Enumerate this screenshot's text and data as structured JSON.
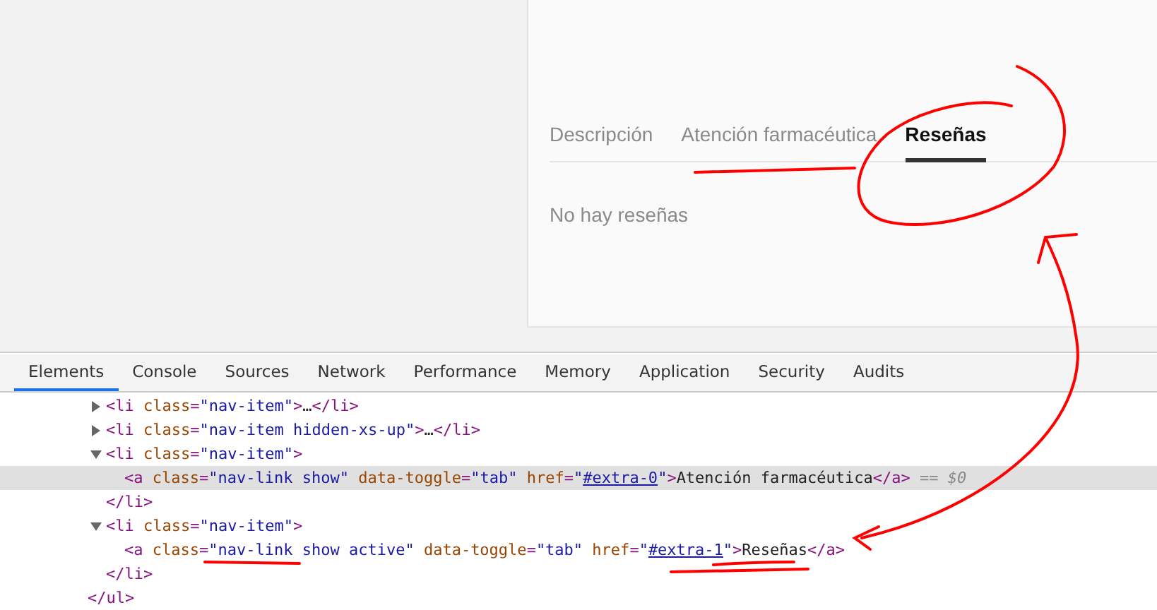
{
  "product_card": {
    "tabs": [
      {
        "label": "Descripción",
        "selected": false
      },
      {
        "label": "Atención farmacéutica",
        "selected": false
      },
      {
        "label": "Reseñas",
        "selected": true
      }
    ],
    "message": "No hay reseñas"
  },
  "devtools": {
    "tabs": [
      {
        "label": "Elements",
        "selected": true
      },
      {
        "label": "Console",
        "selected": false
      },
      {
        "label": "Sources",
        "selected": false
      },
      {
        "label": "Network",
        "selected": false
      },
      {
        "label": "Performance",
        "selected": false
      },
      {
        "label": "Memory",
        "selected": false
      },
      {
        "label": "Application",
        "selected": false
      },
      {
        "label": "Security",
        "selected": false
      },
      {
        "label": "Audits",
        "selected": false
      }
    ],
    "dom": {
      "children": [
        {
          "kind": "element",
          "expanded": false,
          "selected": false,
          "tokens": [
            {
              "kind": "tag",
              "t": "<li"
            },
            {
              "kind": "attr",
              "t": " class"
            },
            {
              "kind": "tag",
              "t": "="
            },
            {
              "kind": "value",
              "t": "\"nav-item\""
            },
            {
              "kind": "tag",
              "t": ">"
            },
            {
              "kind": "text",
              "t": "…"
            },
            {
              "kind": "tag",
              "t": "</li>"
            }
          ]
        },
        {
          "kind": "element",
          "expanded": false,
          "selected": false,
          "tokens": [
            {
              "kind": "tag",
              "t": "<li"
            },
            {
              "kind": "attr",
              "t": " class"
            },
            {
              "kind": "tag",
              "t": "="
            },
            {
              "kind": "value",
              "t": "\"nav-item hidden-xs-up\""
            },
            {
              "kind": "tag",
              "t": ">"
            },
            {
              "kind": "text",
              "t": "…"
            },
            {
              "kind": "tag",
              "t": "</li>"
            }
          ]
        },
        {
          "kind": "element",
          "expanded": true,
          "selected": false,
          "tokens": [
            {
              "kind": "tag",
              "t": "<li"
            },
            {
              "kind": "attr",
              "t": " class"
            },
            {
              "kind": "tag",
              "t": "="
            },
            {
              "kind": "value",
              "t": "\"nav-item\""
            },
            {
              "kind": "tag",
              "t": ">"
            }
          ],
          "closing": "</li>",
          "children": [
            {
              "kind": "leaf",
              "selected": true,
              "suffix": "== $0",
              "tokens": [
                {
                  "kind": "tag",
                  "t": "<a"
                },
                {
                  "kind": "attr",
                  "t": " class"
                },
                {
                  "kind": "tag",
                  "t": "="
                },
                {
                  "kind": "value",
                  "t": "\"nav-link show\""
                },
                {
                  "kind": "attr",
                  "t": " data-toggle"
                },
                {
                  "kind": "tag",
                  "t": "="
                },
                {
                  "kind": "value",
                  "t": "\"tab\""
                },
                {
                  "kind": "attr",
                  "t": " href"
                },
                {
                  "kind": "tag",
                  "t": "="
                },
                {
                  "kind": "value",
                  "t": "\""
                },
                {
                  "kind": "link",
                  "t": "#extra-0"
                },
                {
                  "kind": "value",
                  "t": "\""
                },
                {
                  "kind": "tag",
                  "t": ">"
                },
                {
                  "kind": "text",
                  "t": "Atención farmacéutica"
                },
                {
                  "kind": "tag",
                  "t": "</a>"
                }
              ]
            }
          ]
        },
        {
          "kind": "element",
          "expanded": true,
          "selected": false,
          "tokens": [
            {
              "kind": "tag",
              "t": "<li"
            },
            {
              "kind": "attr",
              "t": " class"
            },
            {
              "kind": "tag",
              "t": "="
            },
            {
              "kind": "value",
              "t": "\"nav-item\""
            },
            {
              "kind": "tag",
              "t": ">"
            }
          ],
          "closing": "</li>",
          "children": [
            {
              "kind": "leaf",
              "selected": false,
              "tokens": [
                {
                  "kind": "tag",
                  "t": "<a"
                },
                {
                  "kind": "attr",
                  "t": " class"
                },
                {
                  "kind": "tag",
                  "t": "="
                },
                {
                  "kind": "value",
                  "t": "\"nav-link show active\""
                },
                {
                  "kind": "attr",
                  "t": " data-toggle"
                },
                {
                  "kind": "tag",
                  "t": "="
                },
                {
                  "kind": "value",
                  "t": "\"tab\""
                },
                {
                  "kind": "attr",
                  "t": " href"
                },
                {
                  "kind": "tag",
                  "t": "="
                },
                {
                  "kind": "value",
                  "t": "\""
                },
                {
                  "kind": "link",
                  "t": "#extra-1"
                },
                {
                  "kind": "value",
                  "t": "\""
                },
                {
                  "kind": "tag",
                  "t": ">"
                },
                {
                  "kind": "text",
                  "t": "Reseñas"
                },
                {
                  "kind": "tag",
                  "t": "</a>"
                }
              ]
            }
          ]
        }
      ],
      "closing": "</ul>"
    }
  }
}
